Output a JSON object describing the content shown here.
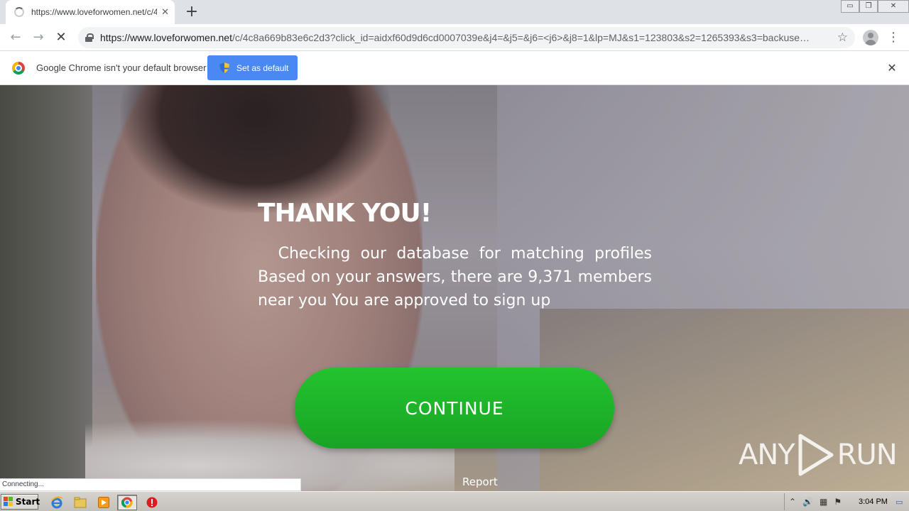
{
  "browser": {
    "tab": {
      "title": "https://www.loveforwomen.net/c/4c8a",
      "close_glyph": "✕"
    },
    "new_tab_glyph": "+",
    "window_controls": {
      "minimize": "▭",
      "maximize": "❐",
      "close": "✕"
    },
    "nav": {
      "back_glyph": "←",
      "forward_glyph": "→",
      "stop_glyph": "✕",
      "star_glyph": "☆",
      "menu_glyph": "⋮"
    },
    "url": {
      "host": "https://www.loveforwomen.net",
      "rest": "/c/4c8a669b83e6c2d3?click_id=aidxf60d9d6cd0007039e&j4=&j5=&j6=<j6>&j8=1&lp=MJ&s1=123803&s2=1265393&s3=backuse…"
    },
    "infobar": {
      "message": "Google Chrome isn't your default browser",
      "button_label": "Set as default",
      "close_glyph": "✕"
    },
    "status_bubble": "Connecting..."
  },
  "page": {
    "headline": "THANK YOU!",
    "body": "  Checking our database for matching profiles Based on your answers, there are 9,371 members near you You are approved to sign up",
    "continue_label": "CONTINUE",
    "report_label": "Report",
    "watermark": {
      "left": "ANY",
      "right": "RUN"
    }
  },
  "taskbar": {
    "start_label": "Start",
    "clock": "3:04 PM",
    "tray_glyphs": [
      "⌃",
      "🔊",
      "▦",
      "⚑",
      "▭"
    ]
  },
  "colors": {
    "continue_green": "#1fb82b",
    "set_default_blue": "#4a89f3"
  }
}
